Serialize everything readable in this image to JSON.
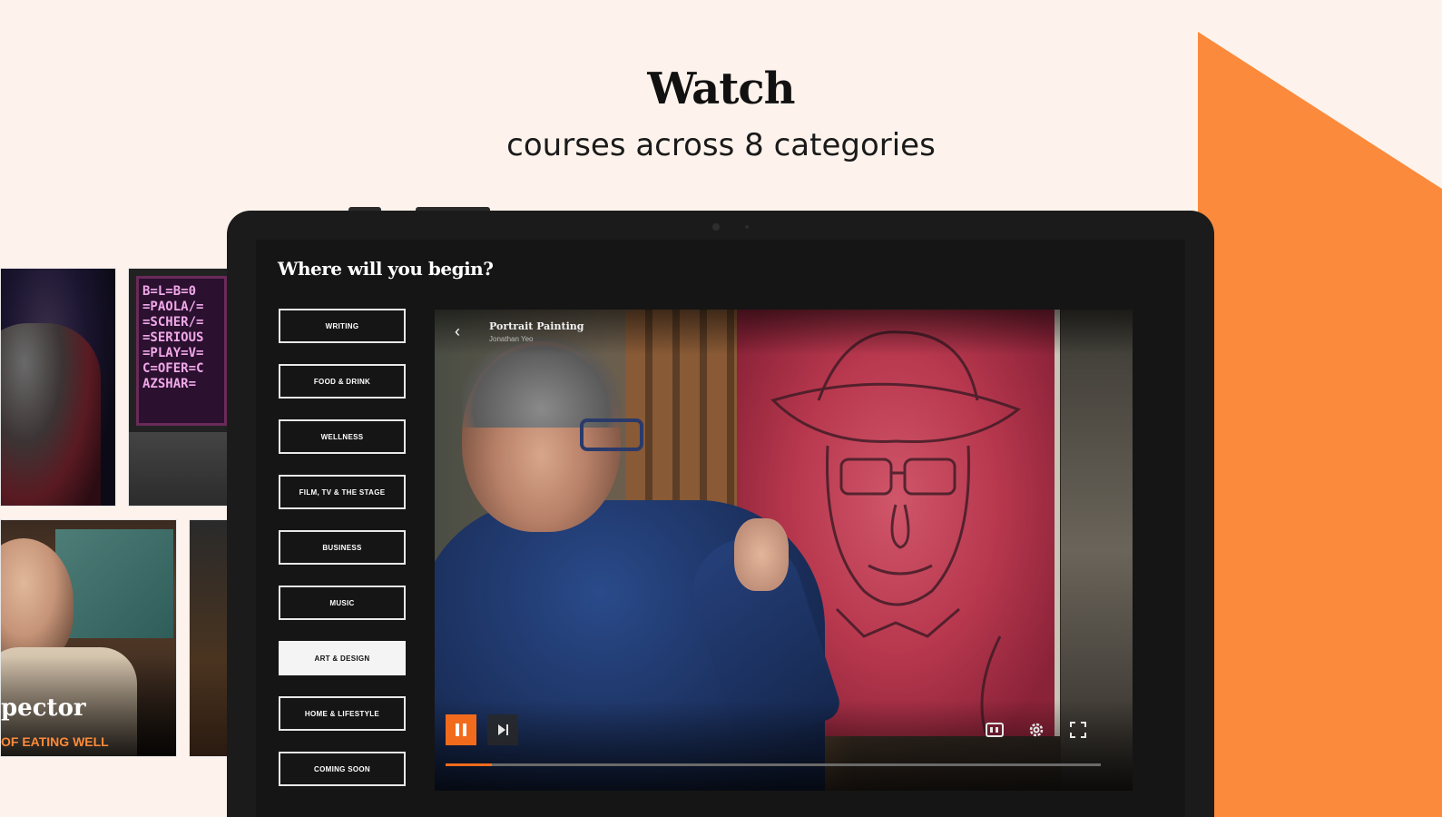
{
  "hero": {
    "title": "Watch",
    "subtitle": "courses across 8 categories"
  },
  "side_thumbnails": {
    "board_text": "B=L=B=0\n=PAOLA/=\n=SCHER/=\n=SERIOUS\n=PLAY=V=\nC=OFER=C\nAZSHAR=",
    "instructor_name_fragment": "pector",
    "course_tagline_fragment": "OF EATING WELL"
  },
  "app": {
    "heading": "Where will you begin?",
    "categories": [
      {
        "label": "WRITING",
        "active": false
      },
      {
        "label": "FOOD & DRINK",
        "active": false
      },
      {
        "label": "WELLNESS",
        "active": false
      },
      {
        "label": "FILM, TV & THE STAGE",
        "active": false
      },
      {
        "label": "BUSINESS",
        "active": false
      },
      {
        "label": "MUSIC",
        "active": false
      },
      {
        "label": "ART & DESIGN",
        "active": true
      },
      {
        "label": "HOME & LIFESTYLE",
        "active": false
      },
      {
        "label": "COMING SOON",
        "active": false
      }
    ]
  },
  "player": {
    "title": "Portrait Painting",
    "subtitle": "Jonathan Yeo",
    "progress": 0.07,
    "accent_color": "#f26b1d",
    "icons": [
      "back-icon",
      "pause-icon",
      "skip-next-icon",
      "captions-icon",
      "settings-gear-icon",
      "fullscreen-icon"
    ]
  },
  "colors": {
    "background": "#fdf3ec",
    "orange_shape": "#fb8a3c",
    "tablet": "#1b1b1b"
  }
}
